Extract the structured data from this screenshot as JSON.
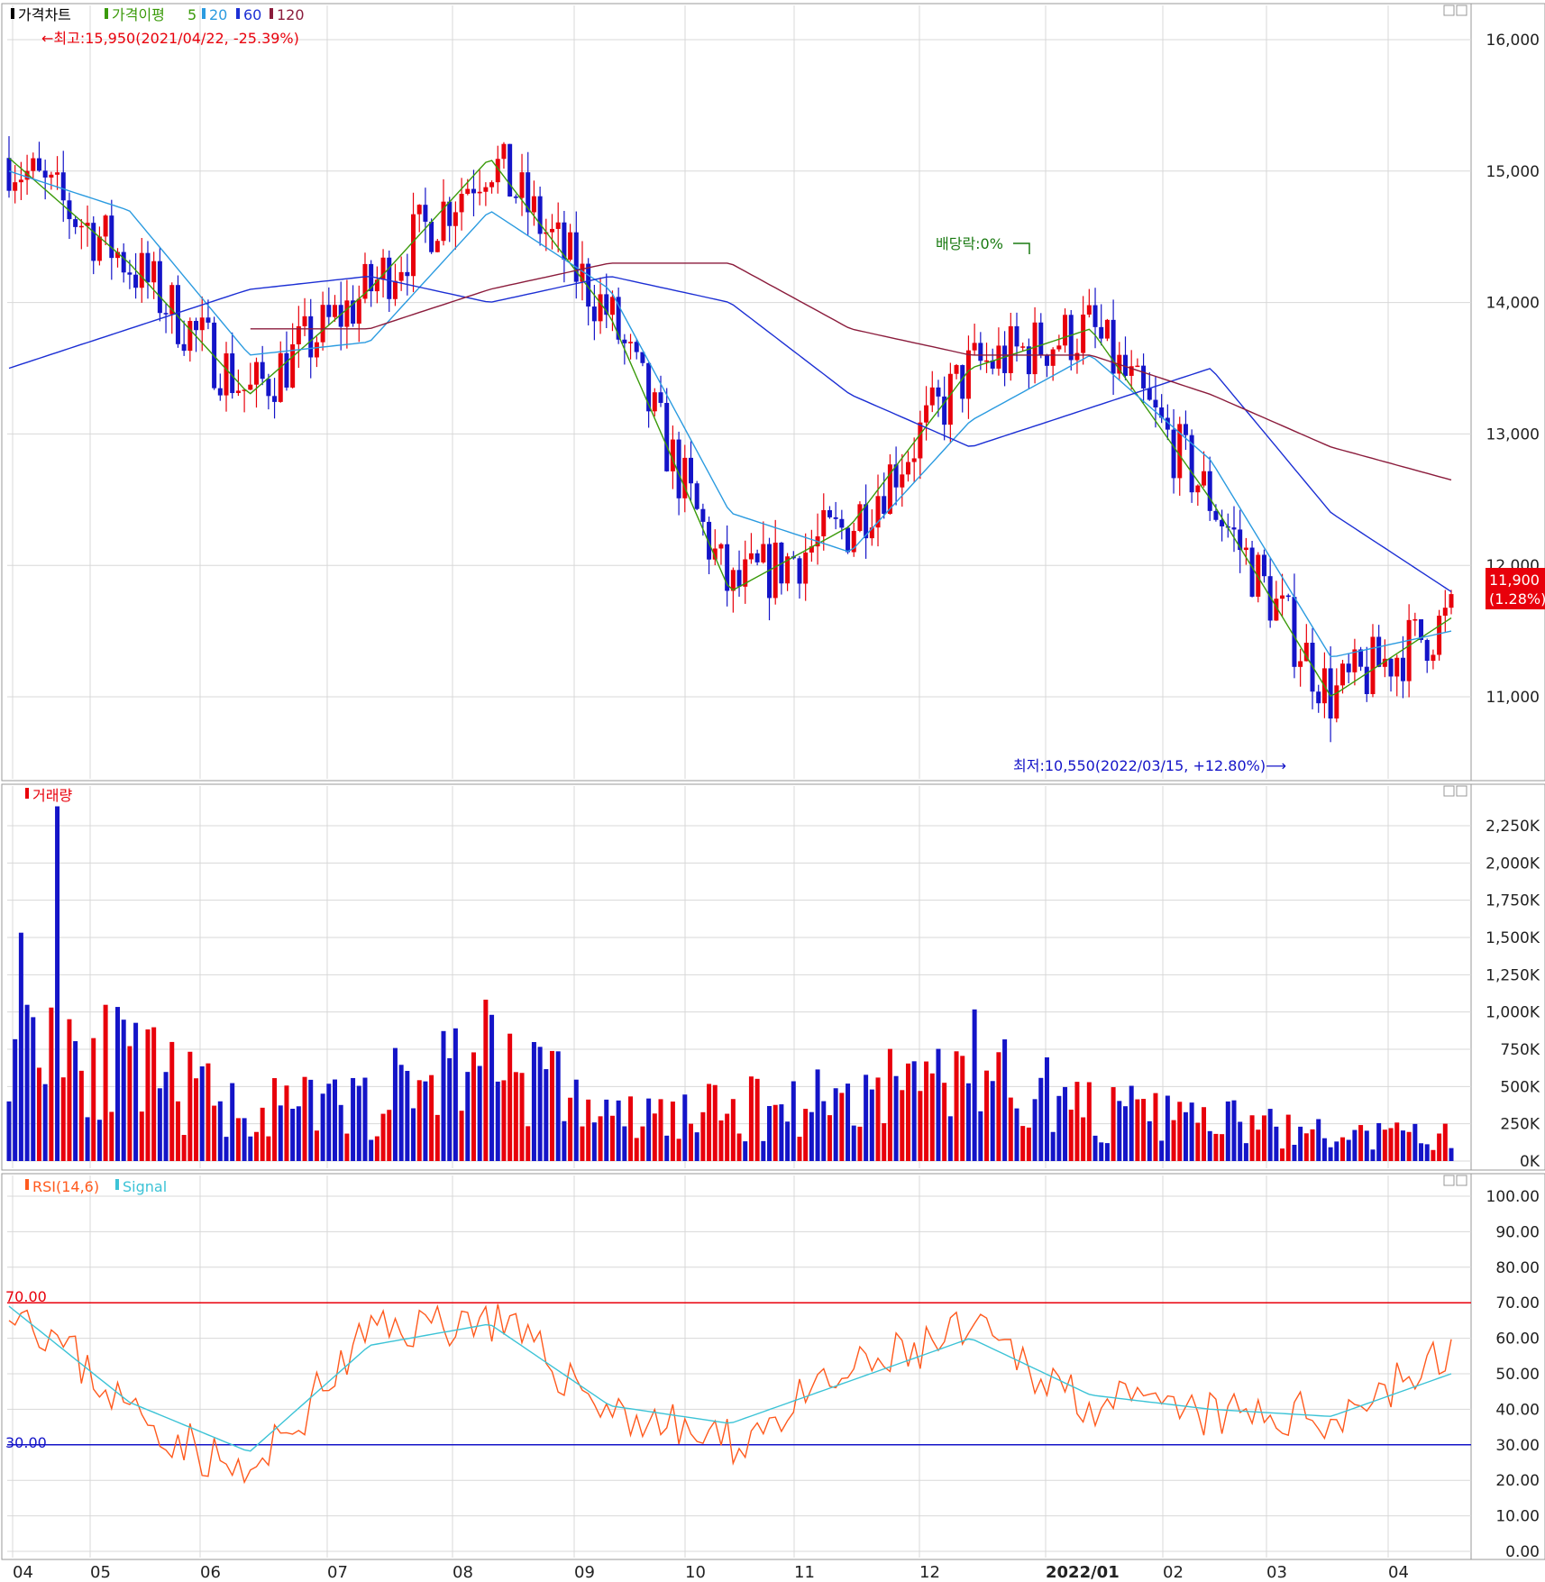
{
  "colors": {
    "up": "#e8000b",
    "down": "#1414c8",
    "ma5": "#3a9a0a",
    "ma20": "#2b9be0",
    "ma60": "#1c2fd4",
    "ma120": "#8b1c3c",
    "rsi": "#ff5a1e",
    "signal": "#3cc3d6",
    "grid": "#d8d8d8"
  },
  "price_panel": {
    "legend": {
      "title": "가격차트",
      "ma_label": "가격이평",
      "ma5": "5",
      "ma20": "20",
      "ma60": "60",
      "ma120": "120"
    },
    "high_annotation": "←최고:15,950(2021/04/22, -25.39%)",
    "low_annotation": "최저:10,550(2022/03/15, +12.80%)⟶",
    "dividend_annotation": "배당락:0%",
    "last_price": "11,900",
    "last_change": "(1.28%)",
    "y_ticks": [
      "16,000",
      "15,000",
      "14,000",
      "13,000",
      "12,000",
      "11,000"
    ]
  },
  "volume_panel": {
    "legend": "거래량",
    "y_ticks": [
      "2,250K",
      "2,000K",
      "1,750K",
      "1,500K",
      "1,250K",
      "1,000K",
      "750K",
      "500K",
      "250K",
      "0K"
    ]
  },
  "rsi_panel": {
    "legend_rsi": "RSI(14,6)",
    "legend_signal": "Signal",
    "upper_label": "70.00",
    "lower_label": "30.00",
    "y_ticks": [
      "100.00",
      "90.00",
      "80.00",
      "70.00",
      "60.00",
      "50.00",
      "40.00",
      "30.00",
      "20.00",
      "10.00",
      "0.00"
    ]
  },
  "x_axis": {
    "labels": [
      "04",
      "05",
      "06",
      "07",
      "08",
      "09",
      "10",
      "11",
      "12",
      "2022/01",
      "02",
      "03",
      "04"
    ]
  },
  "chart_data": [
    {
      "type": "candlestick",
      "title": "가격차트",
      "ylim": [
        10400,
        16200
      ],
      "x": [
        "2021-04",
        "2021-05",
        "2021-06",
        "2021-07",
        "2021-08",
        "2021-09",
        "2021-10",
        "2021-11",
        "2021-12",
        "2022-01",
        "2022-02",
        "2022-03",
        "2022-04"
      ],
      "series": [
        {
          "name": "가격이평 5",
          "y": [
            15100,
            14300,
            13300,
            14100,
            15100,
            13900,
            11800,
            12300,
            13500,
            13800,
            12500,
            11000,
            11600
          ]
        },
        {
          "name": "20",
          "y": [
            15000,
            14700,
            13600,
            13700,
            14700,
            14100,
            12400,
            12100,
            13100,
            13600,
            12800,
            11300,
            11500
          ]
        },
        {
          "name": "60",
          "y": [
            13500,
            13800,
            14100,
            14200,
            14000,
            14200,
            14000,
            13300,
            12900,
            13200,
            13500,
            12400,
            11800
          ]
        },
        {
          "name": "120",
          "y": [
            null,
            null,
            null,
            13800,
            14100,
            14300,
            14300,
            13800,
            13600,
            13600,
            13300,
            12900,
            12650
          ]
        }
      ],
      "annotations": [
        "최고:15,950(2021/04/22, -25.39%)",
        "최저:10,550(2022/03/15, +12.80%)",
        "배당락:0%"
      ],
      "last_value": 11900,
      "last_change_pct": 1.28
    },
    {
      "type": "bar",
      "title": "거래량",
      "ylim": [
        0,
        2400000
      ],
      "x": [
        "2021-04",
        "2021-05",
        "2021-06",
        "2021-07",
        "2021-08",
        "2021-09",
        "2021-10",
        "2021-11",
        "2021-12",
        "2022-01",
        "2022-02",
        "2022-03",
        "2022-04"
      ],
      "values": [
        1000000,
        550000,
        300000,
        350000,
        700000,
        250000,
        300000,
        400000,
        600000,
        300000,
        250000,
        150000,
        150000
      ],
      "max_value": 2380000
    },
    {
      "type": "line",
      "title": "RSI(14,6)",
      "ylim": [
        0,
        100
      ],
      "x": [
        "2021-04",
        "2021-05",
        "2021-06",
        "2021-07",
        "2021-08",
        "2021-09",
        "2021-10",
        "2021-11",
        "2021-12",
        "2022-01",
        "2022-02",
        "2022-03",
        "2022-04"
      ],
      "series": [
        {
          "name": "RSI(14,6)",
          "y": [
            72,
            40,
            20,
            62,
            66,
            40,
            30,
            50,
            62,
            42,
            38,
            38,
            55
          ]
        },
        {
          "name": "Signal",
          "y": [
            69,
            42,
            28,
            58,
            64,
            41,
            36,
            48,
            60,
            44,
            40,
            38,
            50
          ]
        }
      ],
      "reference_lines": [
        70,
        30
      ]
    }
  ]
}
